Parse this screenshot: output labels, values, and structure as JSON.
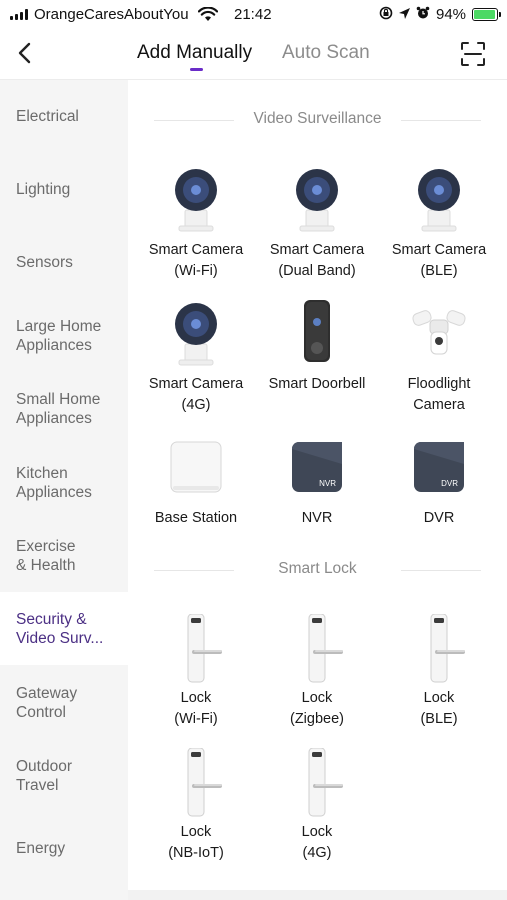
{
  "status_bar": {
    "carrier": "OrangeCaresAboutYou",
    "time": "21:42",
    "battery_percent": "94%",
    "battery_level": 0.94,
    "icons": [
      "signal-icon",
      "wifi-icon",
      "screen-lock-icon",
      "location-icon",
      "alarm-icon",
      "battery-icon"
    ]
  },
  "nav": {
    "back_icon": "chevron-left-icon",
    "tabs": [
      {
        "label": "Add Manually",
        "active": true
      },
      {
        "label": "Auto Scan",
        "active": false
      }
    ],
    "scan_icon": "scan-frame-icon",
    "accent_color": "#6a2cc8"
  },
  "sidebar": {
    "items": [
      {
        "label": "Electrical"
      },
      {
        "label": "Lighting"
      },
      {
        "label": "Sensors"
      },
      {
        "label": "Large Home\nAppliances"
      },
      {
        "label": "Small Home\nAppliances"
      },
      {
        "label": "Kitchen\nAppliances"
      },
      {
        "label": "Exercise\n& Health"
      },
      {
        "label": "Security &\nVideo Surv...",
        "active": true
      },
      {
        "label": "Gateway\nControl"
      },
      {
        "label": "Outdoor\nTravel"
      },
      {
        "label": "Energy"
      }
    ]
  },
  "sections": [
    {
      "title": "Video Surveillance",
      "devices": [
        {
          "label": "Smart Camera\n(Wi-Fi)",
          "icon": "camera-icon"
        },
        {
          "label": "Smart Camera\n(Dual Band)",
          "icon": "camera-icon"
        },
        {
          "label": "Smart Camera\n(BLE)",
          "icon": "camera-icon"
        },
        {
          "label": "Smart Camera\n(4G)",
          "icon": "camera-icon"
        },
        {
          "label": "Smart Doorbell",
          "icon": "doorbell-icon"
        },
        {
          "label": "Floodlight\nCamera",
          "icon": "floodlight-camera-icon"
        },
        {
          "label": "Base Station",
          "icon": "base-station-icon"
        },
        {
          "label": "NVR",
          "icon": "nvr-icon",
          "badge": "NVR"
        },
        {
          "label": "DVR",
          "icon": "dvr-icon",
          "badge": "DVR"
        }
      ]
    },
    {
      "title": "Smart Lock",
      "devices": [
        {
          "label": "Lock\n(Wi-Fi)",
          "icon": "lock-icon"
        },
        {
          "label": "Lock\n(Zigbee)",
          "icon": "lock-icon"
        },
        {
          "label": "Lock\n(BLE)",
          "icon": "lock-icon"
        },
        {
          "label": "Lock\n(NB-IoT)",
          "icon": "lock-icon"
        },
        {
          "label": "Lock\n(4G)",
          "icon": "lock-icon"
        }
      ]
    }
  ]
}
